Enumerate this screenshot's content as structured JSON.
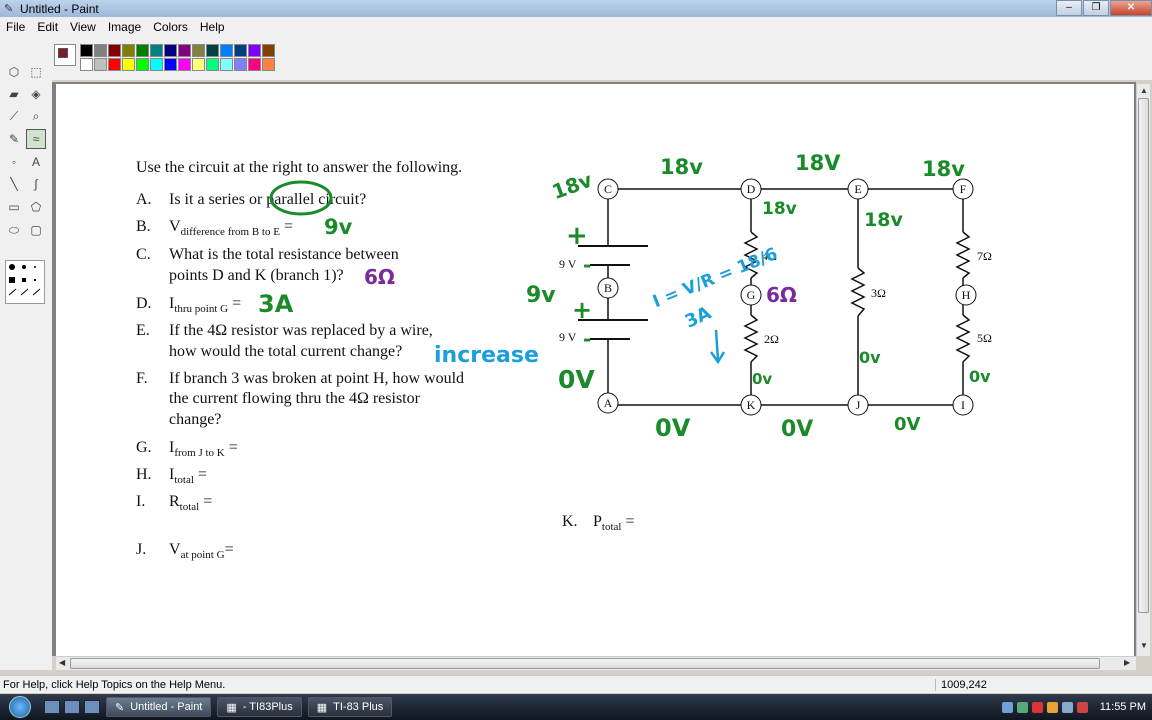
{
  "window": {
    "title": "Untitled - Paint",
    "minimize": "–",
    "restore": "❐",
    "close": "✕"
  },
  "menu": [
    "File",
    "Edit",
    "View",
    "Image",
    "Colors",
    "Help"
  ],
  "colors": {
    "foreground": "#7f1c2c",
    "palette_top": [
      "#000000",
      "#808080",
      "#800000",
      "#808000",
      "#008000",
      "#008080",
      "#000080",
      "#800080",
      "#808040",
      "#004040",
      "#0080ff",
      "#004080",
      "#8000ff",
      "#804000"
    ],
    "palette_bottom": [
      "#ffffff",
      "#c0c0c0",
      "#ff0000",
      "#ffff00",
      "#00ff00",
      "#00ffff",
      "#0000ff",
      "#ff00ff",
      "#ffff80",
      "#00ff80",
      "#80ffff",
      "#8080ff",
      "#ff0080",
      "#ff8040"
    ],
    "ink_green": "#1a8a2a",
    "ink_blue": "#1aa0d8",
    "ink_purple": "#7a2a9a"
  },
  "worksheet": {
    "intro": "Use the circuit at the right to answer the following.",
    "questions": [
      {
        "label": "A.",
        "text": "Is it a series or parallel circuit?"
      },
      {
        "label": "B.",
        "main": "V",
        "sub": "difference from B to E",
        "tail": " ="
      },
      {
        "label": "C.",
        "line1": "What is the total resistance between",
        "line2": "points D and K (branch 1)?"
      },
      {
        "label": "D.",
        "main": "I",
        "sub": "thru point G",
        "tail": " ="
      },
      {
        "label": "E.",
        "line1": "If the 4Ω resistor was replaced by a wire,",
        "line2": "how would the total current change?"
      },
      {
        "label": "F.",
        "line1": "If branch 3 was broken at point H, how would",
        "line2": "the current flowing thru the 4Ω resistor",
        "line3": "change?"
      },
      {
        "label": "G.",
        "main": "I",
        "sub": "from J to K",
        "tail": " ="
      },
      {
        "label": "H.",
        "main": "I",
        "sub": "total",
        "tail": " ="
      },
      {
        "label": "I.",
        "main": "R",
        "sub": "total",
        "tail": " ="
      },
      {
        "label": "J.",
        "main": "V",
        "sub": "at point G",
        "tail": "="
      },
      {
        "label": "K.",
        "main": "P",
        "sub": "total",
        "tail": " ="
      }
    ]
  },
  "circuit": {
    "nodes": [
      "C",
      "D",
      "E",
      "F",
      "B",
      "G",
      "H",
      "A",
      "K",
      "J",
      "I"
    ],
    "battery_top": "9 V",
    "battery_bottom": "9 V",
    "resistors": [
      "4Ω",
      "2Ω",
      "3Ω",
      "7Ω",
      "5Ω"
    ]
  },
  "handwriting": {
    "node_c": "18v",
    "top_cd": "18v",
    "top_de": "18V",
    "top_ef": "18v",
    "node_d": "18v",
    "node_e": "18v",
    "b_answer": "9v",
    "c_answer": "6Ω",
    "d_answer": "3A",
    "e_answer": "increase",
    "left_b": "9v",
    "left_a": "0V",
    "ohm_label": "I = V/R = 18/6",
    "amps": "3A",
    "node_g": "6Ω",
    "k_ov": "0v",
    "j_ov": "0v",
    "i_ov": "0v",
    "bottom_ak": "0V",
    "bottom_kj": "0V",
    "bottom_ji": "0V"
  },
  "status": {
    "help": "For Help, click Help Topics on the Help Menu.",
    "coords": "1009,242"
  },
  "taskbar": {
    "tasks": [
      "Untitled - Paint",
      "- TI83Plus",
      "TI-83 Plus"
    ],
    "clock": "11:55 PM"
  }
}
